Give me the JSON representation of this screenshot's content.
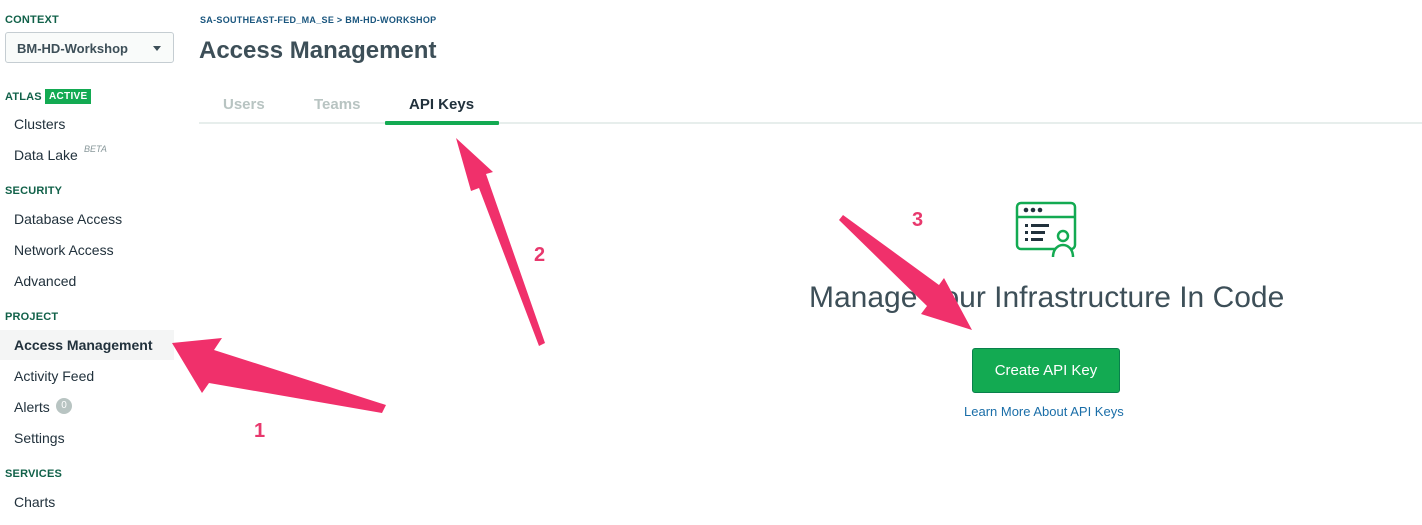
{
  "sidebar": {
    "context_label": "CONTEXT",
    "context_value": "BM-HD-Workshop",
    "sections": [
      {
        "label": "ATLAS",
        "badge": "ACTIVE",
        "items": [
          {
            "label": "Clusters"
          },
          {
            "label": "Data Lake",
            "tag": "BETA"
          }
        ]
      },
      {
        "label": "SECURITY",
        "items": [
          {
            "label": "Database Access"
          },
          {
            "label": "Network Access"
          },
          {
            "label": "Advanced"
          }
        ]
      },
      {
        "label": "PROJECT",
        "items": [
          {
            "label": "Access Management"
          },
          {
            "label": "Activity Feed"
          },
          {
            "label": "Alerts",
            "count": "0"
          },
          {
            "label": "Settings"
          }
        ]
      },
      {
        "label": "SERVICES",
        "items": [
          {
            "label": "Charts"
          }
        ]
      }
    ]
  },
  "header": {
    "breadcrumb": "SA-SOUTHEAST-FED_MA_SE > BM-HD-WORKSHOP",
    "title": "Access Management"
  },
  "tabs": [
    {
      "label": "Users"
    },
    {
      "label": "Teams"
    },
    {
      "label": "API Keys"
    }
  ],
  "active_tab": "API Keys",
  "empty_state": {
    "icon": "code-user-icon",
    "title": "Manage Your Infrastructure In Code",
    "create_button": "Create API Key",
    "learn_link": "Learn More About API Keys"
  },
  "annotations": {
    "steps": [
      "1",
      "2",
      "3"
    ],
    "color": "#f0306b"
  },
  "colors": {
    "accent": "#13aa52",
    "section_label": "#116149",
    "link": "#1a6ea8"
  }
}
